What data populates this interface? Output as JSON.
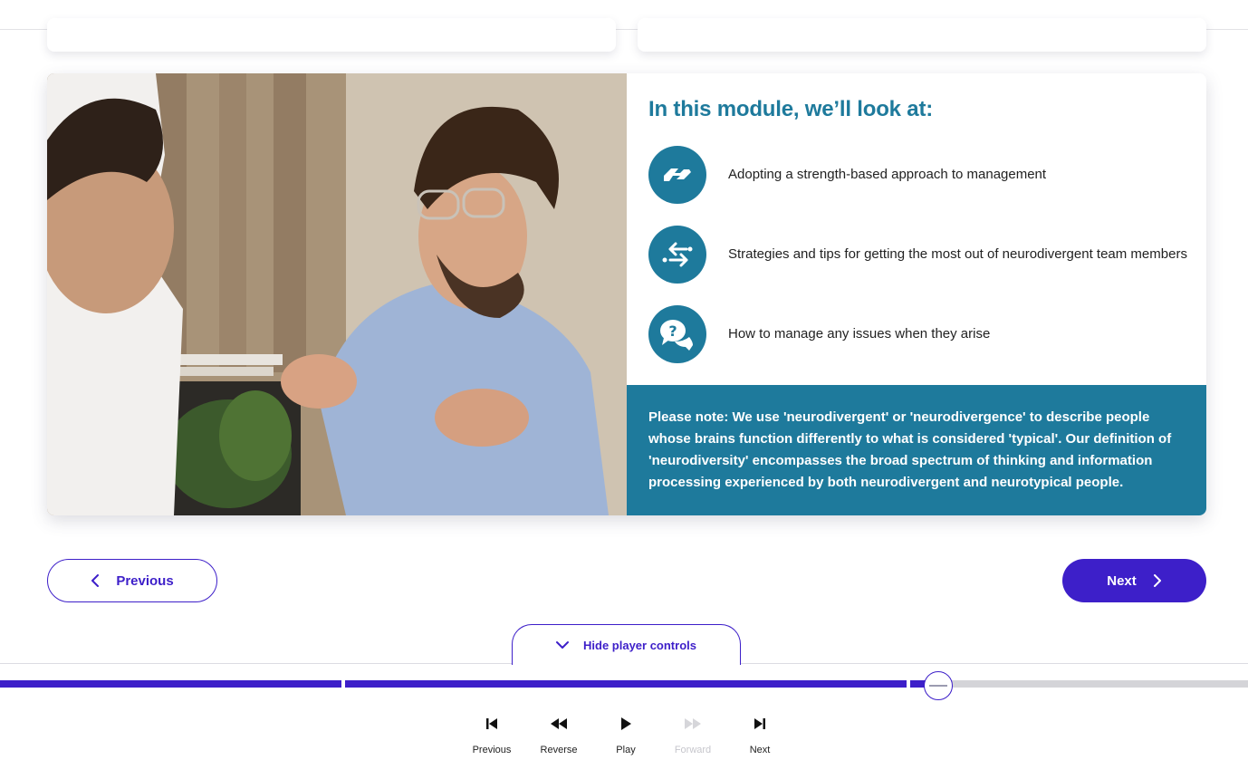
{
  "module": {
    "heading": "In this module, we’ll look at:",
    "topics": [
      {
        "icon": "handshake-icon",
        "text": "Adopting a strength-based approach to management"
      },
      {
        "icon": "swap-arrows-icon",
        "text": "Strategies and tips for getting the most out of neurodivergent team members"
      },
      {
        "icon": "question-chat-icon",
        "text": "How to manage any issues when they arise"
      }
    ],
    "note": "Please note: We use 'neurodivergent' or 'neurodivergence' to describe people whose brains function differently to what is considered 'typical'. Our definition of 'neurodiversity' encompasses the broad spectrum of thinking and information processing experienced by both neurodivergent and neurotypical people."
  },
  "nav": {
    "previous_label": "Previous",
    "next_label": "Next"
  },
  "player": {
    "hide_controls_label": "Hide player controls",
    "progress_fraction": 0.75,
    "controls": [
      {
        "name": "previous",
        "label": "Previous",
        "enabled": true
      },
      {
        "name": "reverse",
        "label": "Reverse",
        "enabled": true
      },
      {
        "name": "play",
        "label": "Play",
        "enabled": true
      },
      {
        "name": "forward",
        "label": "Forward",
        "enabled": false
      },
      {
        "name": "next",
        "label": "Next",
        "enabled": true
      }
    ]
  },
  "colors": {
    "accent": "#3d1fc9",
    "teal": "#1e7a9c",
    "track": "#d4d4d8"
  }
}
